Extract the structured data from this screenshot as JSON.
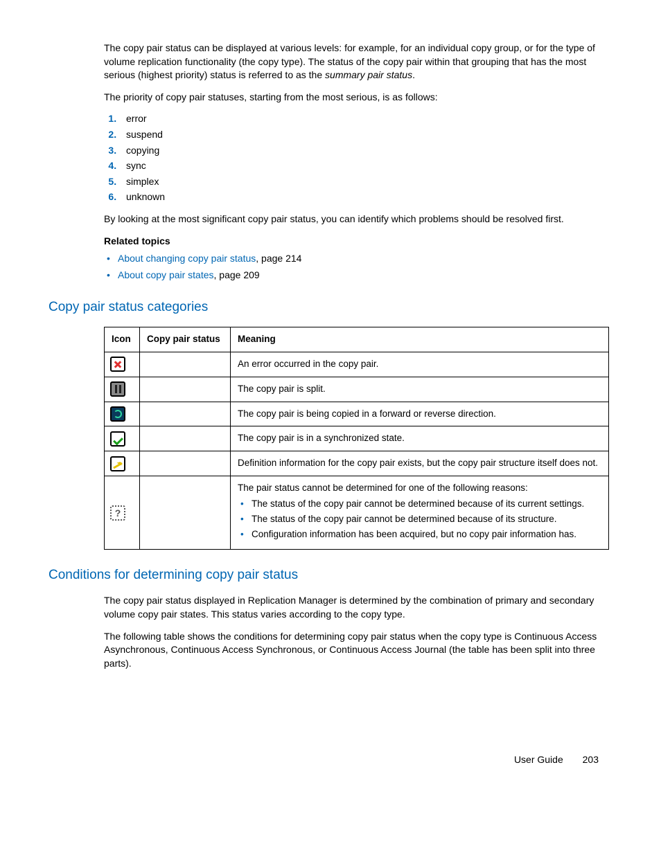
{
  "intro_para": "The copy pair status can be displayed at various levels: for example, for an individual copy group, or for the type of volume replication functionality (the copy type). The status of the copy pair within that grouping that has the most serious (highest priority) status is referred to as the ",
  "intro_term": "summary pair status",
  "intro_end": ".",
  "priority_intro": "The priority of copy pair statuses, starting from the most serious, is as follows:",
  "priority": [
    "error",
    "suspend",
    "copying",
    "sync",
    "simplex",
    "unknown"
  ],
  "after_priority": "By looking at the most significant copy pair status, you can identify which problems should be resolved first.",
  "related_topics_label": "Related topics",
  "related": [
    {
      "link": "About changing copy pair status",
      "suffix": ", page 214"
    },
    {
      "link": "About copy pair states",
      "suffix": ", page 209"
    }
  ],
  "heading_categories": "Copy pair status categories",
  "table_headers": {
    "icon": "Icon",
    "status": "Copy pair status",
    "meaning": "Meaning"
  },
  "rows": {
    "r1_meaning": "An error occurred in the copy pair.",
    "r2_meaning": "The copy pair is split.",
    "r3_meaning": "The copy pair is being copied in a forward or reverse direction.",
    "r4_meaning": "The copy pair is in a synchronized state.",
    "r5_meaning": "Definition information for the copy pair exists, but the copy pair structure itself does not.",
    "r6_intro": "The pair status cannot be determined for one of the following reasons:",
    "r6_b1": "The status of the copy pair cannot be determined because of its current settings.",
    "r6_b2": "The status of the copy pair cannot be determined because of its structure.",
    "r6_b3": "Configuration information has been acquired, but no copy pair information has."
  },
  "heading_conditions": "Conditions for determining copy pair status",
  "conditions_p1": "The copy pair status displayed in Replication Manager is determined by the combination of primary and secondary volume copy pair states. This status varies according to the copy type.",
  "conditions_p2": "The following table shows the conditions for determining copy pair status when the copy type is Continuous Access Asynchronous, Continuous Access Synchronous, or Continuous Access Journal (the table has been split into three parts).",
  "footer_label": "User Guide",
  "footer_page": "203"
}
